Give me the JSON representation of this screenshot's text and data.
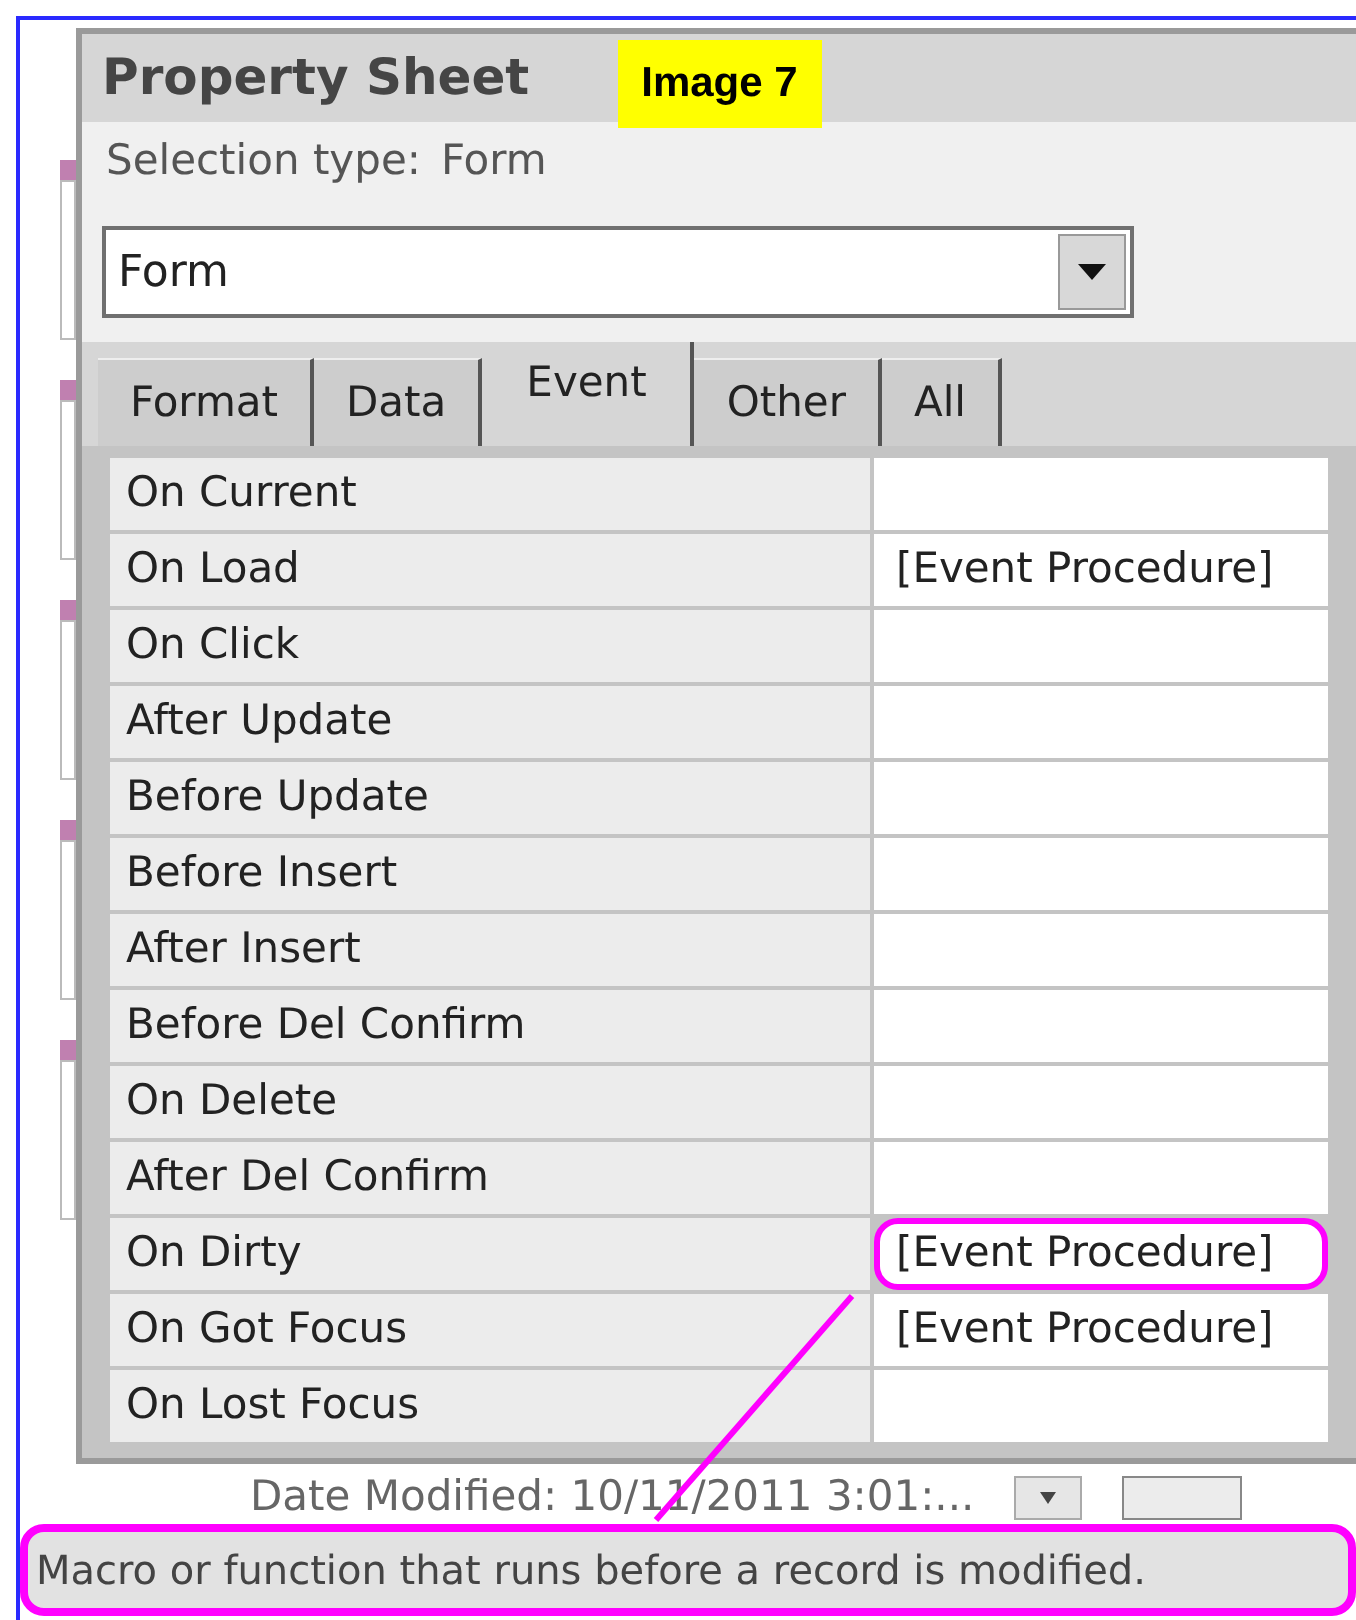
{
  "panel": {
    "title": "Property Sheet",
    "badge": "Image 7",
    "selection_type_label": "Selection type:",
    "selection_type": "Form",
    "combo": {
      "value": "Form"
    },
    "tabs": [
      {
        "label": "Format",
        "selected": false
      },
      {
        "label": "Data",
        "selected": false
      },
      {
        "label": "Event",
        "selected": true
      },
      {
        "label": "Other",
        "selected": false
      },
      {
        "label": "All",
        "selected": false
      }
    ],
    "properties": [
      {
        "name": "On Current",
        "highlighted": false
      },
      {
        "name": "On Load",
        "value": "[Event Procedure]",
        "highlighted": false
      },
      {
        "name": "On Click",
        "highlighted": false
      },
      {
        "name": "After Update",
        "highlighted": false
      },
      {
        "name": "Before Update",
        "highlighted": false
      },
      {
        "name": "Before Insert",
        "highlighted": false
      },
      {
        "name": "After Insert",
        "highlighted": false
      },
      {
        "name": "Before Del Confirm",
        "highlighted": false
      },
      {
        "name": "On Delete",
        "highlighted": false
      },
      {
        "name": "After Del Confirm",
        "highlighted": false
      },
      {
        "name": "On Dirty",
        "value": "[Event Procedure]",
        "highlighted": true
      },
      {
        "name": "On Got Focus",
        "value": "[Event Procedure]",
        "highlighted": false
      },
      {
        "name": "On Lost Focus",
        "highlighted": false
      }
    ]
  },
  "background_form": {
    "date_modified": "Date Modified: 10/11/2011 3:01:..."
  },
  "status_bar": {
    "text": "Macro or function that runs before a record is modified.",
    "highlighted": true
  }
}
